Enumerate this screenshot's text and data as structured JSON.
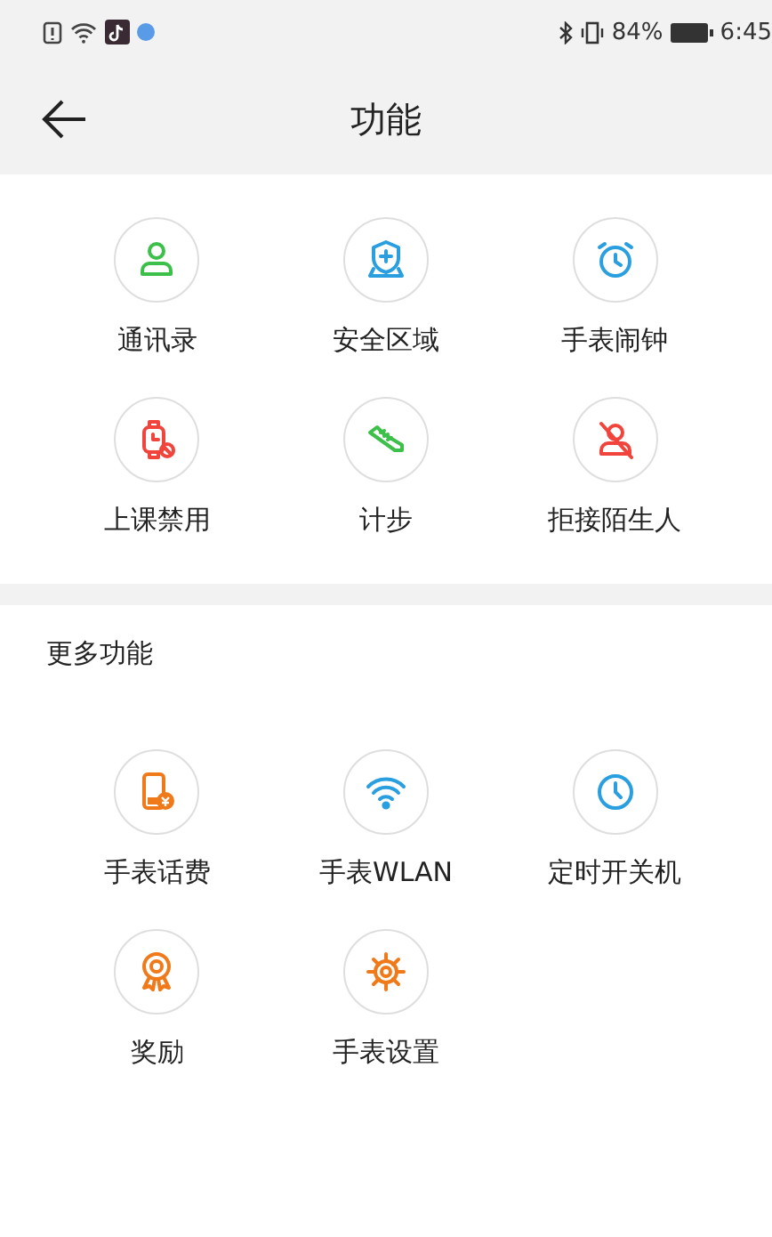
{
  "status_bar": {
    "battery_percent": "84%",
    "time": "6:45"
  },
  "header": {
    "title": "功能"
  },
  "features": [
    {
      "label": "通讯录",
      "kind": "contact",
      "color": "#3cc04a"
    },
    {
      "label": "安全区域",
      "kind": "shield",
      "color": "#2a9fe0"
    },
    {
      "label": "手表闹钟",
      "kind": "alarm",
      "color": "#2a9fe0"
    },
    {
      "label": "上课禁用",
      "kind": "watch-ban",
      "color": "#f0443c"
    },
    {
      "label": "计步",
      "kind": "shoe",
      "color": "#3cc04a"
    },
    {
      "label": "拒接陌生人",
      "kind": "person-off",
      "color": "#f0443c"
    }
  ],
  "more": {
    "title": "更多功能",
    "items": [
      {
        "label": "手表话费",
        "kind": "phone-fee",
        "color": "#f07a1a"
      },
      {
        "label": "手表WLAN",
        "kind": "wifi",
        "color": "#2a9fe0"
      },
      {
        "label": "定时开关机",
        "kind": "clock",
        "color": "#2a9fe0"
      },
      {
        "label": "奖励",
        "kind": "medal",
        "color": "#f07a1a"
      },
      {
        "label": "手表设置",
        "kind": "gear",
        "color": "#f07a1a"
      }
    ]
  }
}
